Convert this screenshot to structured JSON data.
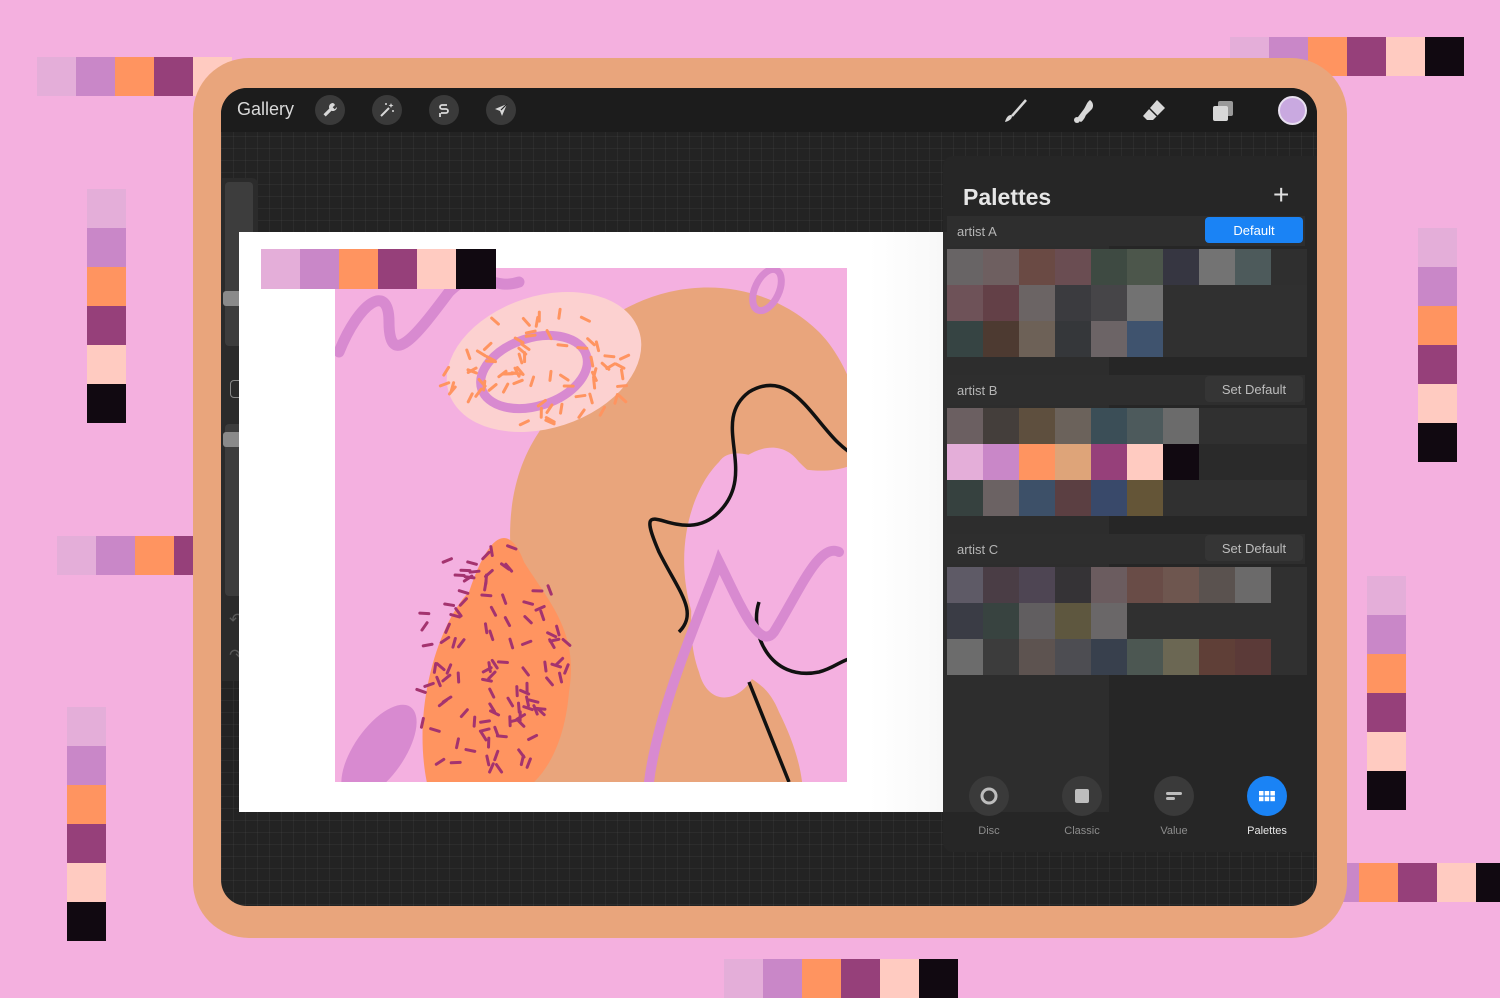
{
  "app": {
    "gallery_label": "Gallery",
    "current_color": "#c9a9e0"
  },
  "toolbar": {
    "left_tools": [
      "wrench-icon",
      "magic-wand-icon",
      "selection-icon",
      "transform-arrow-icon"
    ],
    "right_tools": [
      "brush-icon",
      "smudge-icon",
      "eraser-icon",
      "layers-icon"
    ]
  },
  "artwork_palette": [
    "#e4aed9",
    "#c987c8",
    "#ff9460",
    "#96407a",
    "#ffcbc1",
    "#110911"
  ],
  "palettes_panel": {
    "title": "Palettes",
    "add_icon": "plus-icon",
    "palettes": [
      {
        "name": "artist A",
        "button": "Default",
        "is_default": true,
        "rows": [
          [
            "#686465",
            "#6e5f60",
            "#6a4a44",
            "#6a4d52",
            "#3e4a42",
            "#4c564b",
            "#363641",
            "#737373",
            "#4d5a5b",
            "#2f2f2f"
          ],
          [
            "#6e5258",
            "#634047",
            "#6b6464",
            "#3b3b3f",
            "#464548",
            "#727272",
            "#303030",
            "#303030",
            "#303030",
            "#303030"
          ],
          [
            "#364443",
            "#4d3a31",
            "#6d6157",
            "#35373a",
            "#6c6466",
            "#3f536e",
            "#303030",
            "#303030",
            "#303030",
            "#303030"
          ]
        ]
      },
      {
        "name": "artist B",
        "button": "Set Default",
        "is_default": false,
        "rows": [
          [
            "#6b5f61",
            "#443e3b",
            "#5e4f3e",
            "#6b625b",
            "#3b4e57",
            "#4d5a5c",
            "#6b6b6b",
            "#303030",
            "#303030",
            "#303030"
          ],
          [
            "#e4aed9",
            "#c987c8",
            "#ff9460",
            "#dea479",
            "#96407a",
            "#ffcbc1",
            "#110911",
            "#2a2a2a",
            "#2a2a2a",
            "#2a2a2a"
          ],
          [
            "#36413f",
            "#6b6263",
            "#3d5068",
            "#5b3f42",
            "#39496a",
            "#645537",
            "#303030",
            "#303030",
            "#303030",
            "#303030"
          ]
        ]
      },
      {
        "name": "artist C",
        "button": "Set Default",
        "is_default": false,
        "rows": [
          [
            "#5e5a66",
            "#4a3d45",
            "#4e4553",
            "#353336",
            "#6b5c5f",
            "#694c47",
            "#6e564f",
            "#5a524f",
            "#6b6a6a",
            "#303030"
          ],
          [
            "#3a3c45",
            "#384340",
            "#615e60",
            "#5e573f",
            "#6a6768",
            "#303030",
            "#303030",
            "#303030",
            "#303030",
            "#303030"
          ],
          [
            "#6c6c6c",
            "#3c3c3c",
            "#5d5350",
            "#4d4d52",
            "#38404d",
            "#4c5752",
            "#6b6753",
            "#5f3f37",
            "#5b3a38",
            "#303030"
          ]
        ]
      }
    ],
    "modes": [
      {
        "label": "Disc",
        "icon": "disc-icon",
        "active": false
      },
      {
        "label": "Classic",
        "icon": "classic-square-icon",
        "active": false
      },
      {
        "label": "Value",
        "icon": "value-sliders-icon",
        "active": false
      },
      {
        "label": "Palettes",
        "icon": "palettes-grid-icon",
        "active": true
      }
    ]
  }
}
